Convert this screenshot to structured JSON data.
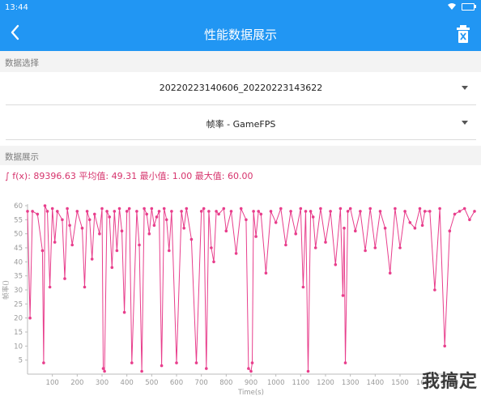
{
  "status_bar": {
    "time": "13:44"
  },
  "app_bar": {
    "title": "性能数据展示"
  },
  "selection_section": {
    "label": "数据选择",
    "session_value": "20220223140606_20220223143622",
    "metric_value": "帧率 - GameFPS"
  },
  "display_section": {
    "label": "数据展示",
    "summary": "∫ f(x): 89396.63 平均值: 49.31 最小值: 1.00 最大值: 60.00"
  },
  "watermark": "我搞定",
  "colors": {
    "accent": "#2196f3",
    "series": "#e83e8c",
    "summary_text": "#d6336c"
  },
  "icons": {
    "back": "chevron-left-icon",
    "trash": "trash-icon",
    "wifi": "wifi-icon",
    "battery": "battery-icon"
  },
  "chart_data": {
    "type": "line",
    "title": "",
    "xlabel": "Time(s)",
    "ylabel": "帧率()",
    "xlim": [
      0,
      1800
    ],
    "ylim": [
      0,
      60
    ],
    "x_ticks": [
      100,
      200,
      300,
      400,
      500,
      600,
      700,
      800,
      900,
      1000,
      1100,
      1200,
      1300,
      1400,
      1500,
      1600,
      1700
    ],
    "y_ticks": [
      5,
      10,
      15,
      20,
      25,
      30,
      35,
      40,
      45,
      50,
      55,
      60
    ],
    "grid": false,
    "series": [
      {
        "x": [
          0,
          10,
          20,
          40,
          60,
          65,
          70,
          80,
          90,
          100,
          110,
          120,
          140,
          150,
          160,
          170,
          180,
          200,
          220,
          230,
          240,
          250,
          260,
          270,
          290,
          300,
          305,
          310,
          320,
          330,
          340,
          350,
          360,
          370,
          380,
          390,
          400,
          410,
          420,
          440,
          450,
          460,
          470,
          480,
          490,
          500,
          510,
          520,
          530,
          540,
          550,
          560,
          570,
          580,
          600,
          620,
          630,
          640,
          660,
          680,
          700,
          710,
          720,
          730,
          740,
          750,
          760,
          770,
          790,
          800,
          820,
          840,
          860,
          880,
          890,
          900,
          905,
          910,
          920,
          930,
          940,
          960,
          980,
          1000,
          1020,
          1040,
          1060,
          1080,
          1100,
          1110,
          1120,
          1130,
          1140,
          1150,
          1160,
          1180,
          1200,
          1220,
          1240,
          1260,
          1270,
          1275,
          1280,
          1290,
          1300,
          1320,
          1340,
          1360,
          1380,
          1400,
          1420,
          1440,
          1460,
          1480,
          1500,
          1520,
          1540,
          1560,
          1580,
          1590,
          1600,
          1620,
          1640,
          1660,
          1680,
          1700,
          1720,
          1740,
          1760,
          1780,
          1800
        ],
        "y": [
          58,
          20,
          58,
          57,
          44,
          4,
          60,
          58,
          31,
          59,
          47,
          58,
          55,
          34,
          59,
          53,
          46,
          58,
          52,
          31,
          58,
          55,
          41,
          57,
          50,
          59,
          2,
          1,
          58,
          56,
          38,
          58,
          44,
          59,
          51,
          22,
          58,
          59,
          4,
          58,
          46,
          1,
          59,
          57,
          50,
          59,
          53,
          56,
          58,
          3,
          59,
          55,
          44,
          58,
          4,
          58,
          52,
          59,
          48,
          4,
          58,
          59,
          2,
          58,
          45,
          40,
          58,
          57,
          59,
          51,
          58,
          43,
          59,
          55,
          2,
          1,
          4,
          58,
          49,
          58,
          57,
          36,
          58,
          54,
          59,
          46,
          58,
          50,
          59,
          31,
          58,
          1,
          58,
          56,
          45,
          59,
          47,
          58,
          39,
          59,
          28,
          52,
          4,
          58,
          59,
          51,
          58,
          44,
          59,
          45,
          58,
          52,
          36,
          59,
          45,
          58,
          54,
          52,
          59,
          53,
          58,
          58,
          30,
          59,
          10,
          51,
          57,
          58,
          59,
          55,
          58
        ]
      }
    ]
  }
}
